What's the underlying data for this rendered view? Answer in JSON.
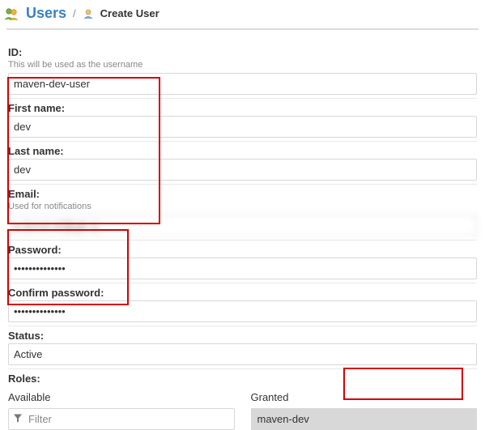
{
  "breadcrumb": {
    "users_label": "Users",
    "separator": "/",
    "current": "Create User"
  },
  "form": {
    "id_label": "ID:",
    "id_hint": "This will be used as the username",
    "id_value": "maven-dev-user",
    "first_name_label": "First name:",
    "first_name_value": "dev",
    "last_name_label": "Last name:",
    "last_name_value": "dev",
    "email_label": "Email:",
    "email_hint": "Used for notifications",
    "email_value": "a.bccd ef@gh.ij",
    "password_label": "Password:",
    "password_value": "••••••••••••••",
    "confirm_password_label": "Confirm password:",
    "confirm_password_value": "••••••••••••••",
    "status_label": "Status:",
    "status_value": "Active",
    "roles_label": "Roles:",
    "roles_available_label": "Available",
    "roles_granted_label": "Granted",
    "filter_placeholder": "Filter",
    "granted_item": "maven-dev"
  }
}
